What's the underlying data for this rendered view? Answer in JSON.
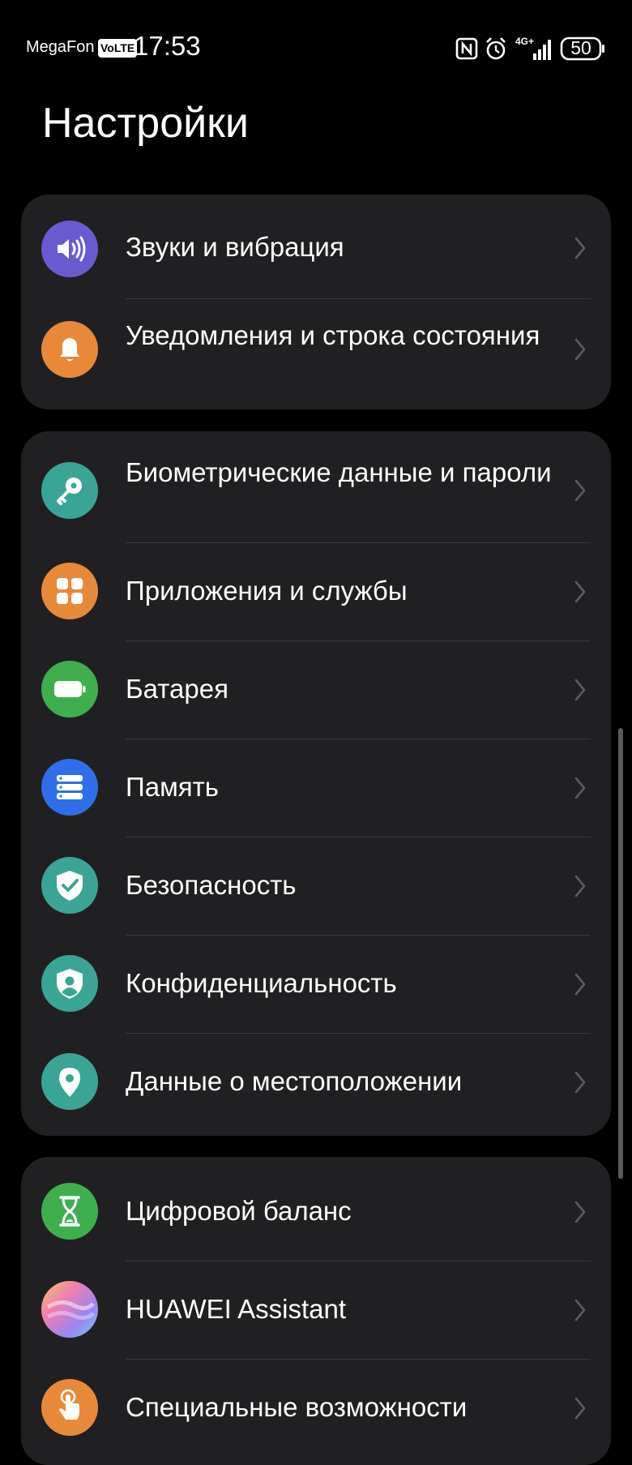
{
  "status_bar": {
    "carrier": "MegaFon",
    "volte_badge": "VoLTE",
    "time": "17:53",
    "network": "4G+",
    "battery_level": "50",
    "icons": [
      "nfc-icon",
      "alarm-icon",
      "signal-icon",
      "battery-icon"
    ]
  },
  "header": {
    "title": "Настройки"
  },
  "groups": [
    {
      "items": [
        {
          "label": "Звуки и вибрация",
          "icon": "sound-icon",
          "color": "#6a5ad0"
        },
        {
          "label": "Уведомления и строка состояния",
          "icon": "bell-icon",
          "color": "#e8893a"
        }
      ]
    },
    {
      "items": [
        {
          "label": "Биометрические данные и пароли",
          "icon": "key-icon",
          "color": "#3aa596"
        },
        {
          "label": "Приложения и службы",
          "icon": "apps-icon",
          "color": "#e8893a"
        },
        {
          "label": "Батарея",
          "icon": "battery-icon",
          "color": "#3fae4f"
        },
        {
          "label": "Память",
          "icon": "storage-icon",
          "color": "#2e6ee8"
        },
        {
          "label": "Безопасность",
          "icon": "shield-check-icon",
          "color": "#3aa596"
        },
        {
          "label": "Конфиденциальность",
          "icon": "privacy-shield-icon",
          "color": "#3aa596"
        },
        {
          "label": "Данные о местоположении",
          "icon": "location-pin-icon",
          "color": "#3aa596"
        }
      ]
    },
    {
      "items": [
        {
          "label": "Цифровой баланс",
          "icon": "hourglass-icon",
          "color": "#3fae4f"
        },
        {
          "label": "HUAWEI Assistant",
          "icon": "assistant-icon",
          "color": "#f07fb0"
        },
        {
          "label": "Специальные возможности",
          "icon": "touch-hand-icon",
          "color": "#e8893a"
        }
      ]
    }
  ]
}
